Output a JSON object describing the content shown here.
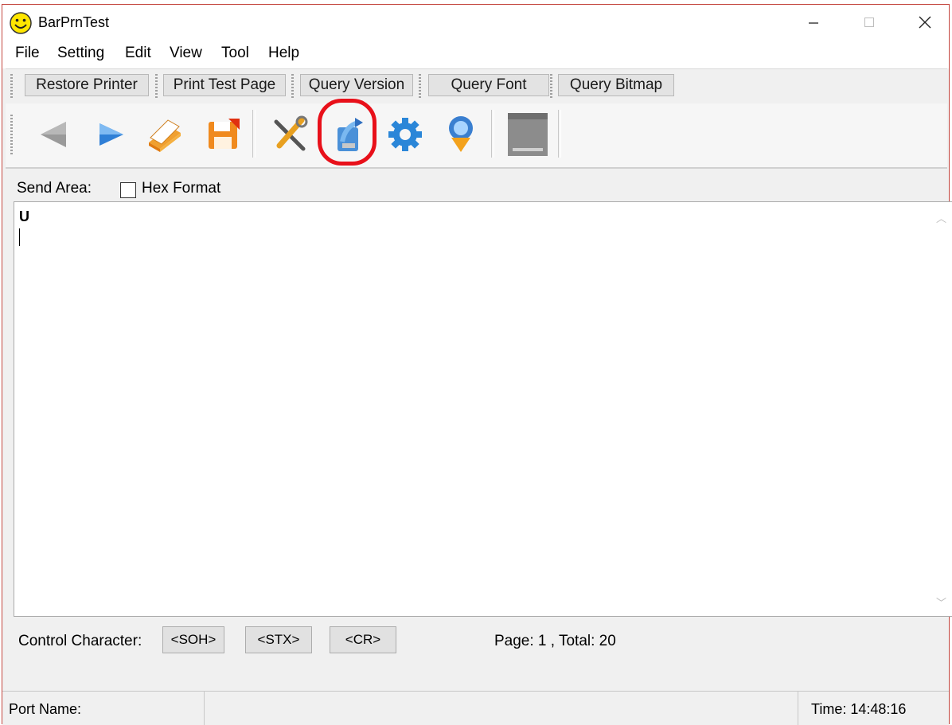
{
  "window": {
    "title": "BarPrnTest",
    "controls": {
      "minimize": "—",
      "maximize": "☐",
      "close": "✕"
    }
  },
  "menu": [
    "File",
    "Setting",
    "Edit",
    "View",
    "Tool",
    "Help"
  ],
  "text_buttons": [
    "Restore Printer",
    "Print Test Page",
    "Query Version",
    "Query Font",
    "Query Bitmap"
  ],
  "toolbar_icons": [
    "back-arrow-icon",
    "forward-arrow-icon",
    "open-folder-icon",
    "save-disk-icon",
    "tools-icon",
    "send-file-icon",
    "settings-gear-icon",
    "download-globe-icon",
    "bitmap-icon"
  ],
  "send_area": {
    "label": "Send Area:",
    "hex_format_label": "Hex Format",
    "hex_format_checked": false,
    "content": "U"
  },
  "control_character": {
    "label": "Control Character:",
    "buttons": [
      "<SOH>",
      "<STX>",
      "<CR>"
    ]
  },
  "page_info": "Page: 1 , Total: 20",
  "status": {
    "port_name": "Port Name:",
    "middle": "",
    "time": "Time: 14:48:16"
  },
  "colors": {
    "highlight": "#e8101a",
    "window_border": "#c4463f",
    "background": "#f0f0f0"
  }
}
